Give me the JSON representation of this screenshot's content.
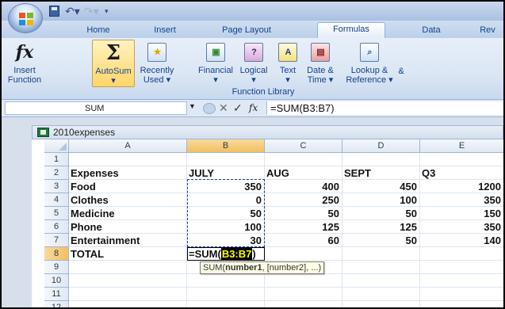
{
  "title_bar": {
    "office_button": "office-button",
    "quick_access": [
      "save-icon",
      "undo-icon",
      "redo-icon",
      "customize-icon"
    ]
  },
  "tabs": [
    {
      "label": "Home",
      "active": false
    },
    {
      "label": "Insert",
      "active": false
    },
    {
      "label": "Page Layout",
      "active": false
    },
    {
      "label": "Formulas",
      "active": true
    },
    {
      "label": "Data",
      "active": false
    },
    {
      "label": "Rev",
      "active": false
    }
  ],
  "ribbon": {
    "group_label": "Function Library",
    "buttons": [
      {
        "line1": "Insert",
        "line2": "Function",
        "icon": "fx-icon"
      },
      {
        "line1": "AutoSum",
        "line2": "▾",
        "icon": "sigma-icon"
      },
      {
        "line1": "Recently",
        "line2": "Used ▾",
        "icon": "star-book-icon"
      },
      {
        "line1": "Financial",
        "line2": "▾",
        "icon": "financial-book-icon"
      },
      {
        "line1": "Logical",
        "line2": "▾",
        "icon": "logical-book-icon"
      },
      {
        "line1": "Text",
        "line2": "▾",
        "icon": "text-book-icon"
      },
      {
        "line1": "Date &",
        "line2": "Time ▾",
        "icon": "calendar-book-icon"
      },
      {
        "line1": "Lookup &",
        "line2": "Reference ▾",
        "icon": "lookup-book-icon"
      },
      {
        "line1": "&",
        "line2": "",
        "icon": ""
      }
    ]
  },
  "formula_bar": {
    "name_box": "SUM",
    "formula": "=SUM(B3:B7)"
  },
  "workbook": {
    "name": "2010expenses"
  },
  "grid": {
    "columns": [
      "A",
      "B",
      "C",
      "D",
      "E"
    ],
    "selected_column": "B",
    "rows": [
      "1",
      "2",
      "3",
      "4",
      "5",
      "6",
      "7",
      "8",
      "9",
      "10",
      "11",
      "12"
    ],
    "selected_row": "8",
    "cells": [
      [
        "",
        "",
        "",
        "",
        ""
      ],
      [
        "Expenses",
        "JULY",
        "AUG",
        "SEPT",
        "Q3"
      ],
      [
        "Food",
        "350",
        "400",
        "450",
        "1200"
      ],
      [
        "Clothes",
        "0",
        "250",
        "100",
        "350"
      ],
      [
        "Medicine",
        "50",
        "50",
        "50",
        "150"
      ],
      [
        "Phone",
        "100",
        "125",
        "125",
        "350"
      ],
      [
        "Entertainment",
        "30",
        "60",
        "50",
        "140"
      ],
      [
        "TOTAL",
        "",
        "",
        "",
        ""
      ],
      [
        "",
        "",
        "",
        "",
        ""
      ],
      [
        "",
        "",
        "",
        "",
        ""
      ],
      [
        "",
        "",
        "",
        "",
        ""
      ],
      [
        "",
        "",
        "",
        "",
        ""
      ]
    ],
    "edit_cell": {
      "prefix": "=SUM(",
      "ref": "B3:B7",
      "suffix": ")"
    },
    "tooltip": {
      "fn": "SUM(",
      "arg1": "number1",
      "rest": ", [number2], ...)"
    }
  }
}
